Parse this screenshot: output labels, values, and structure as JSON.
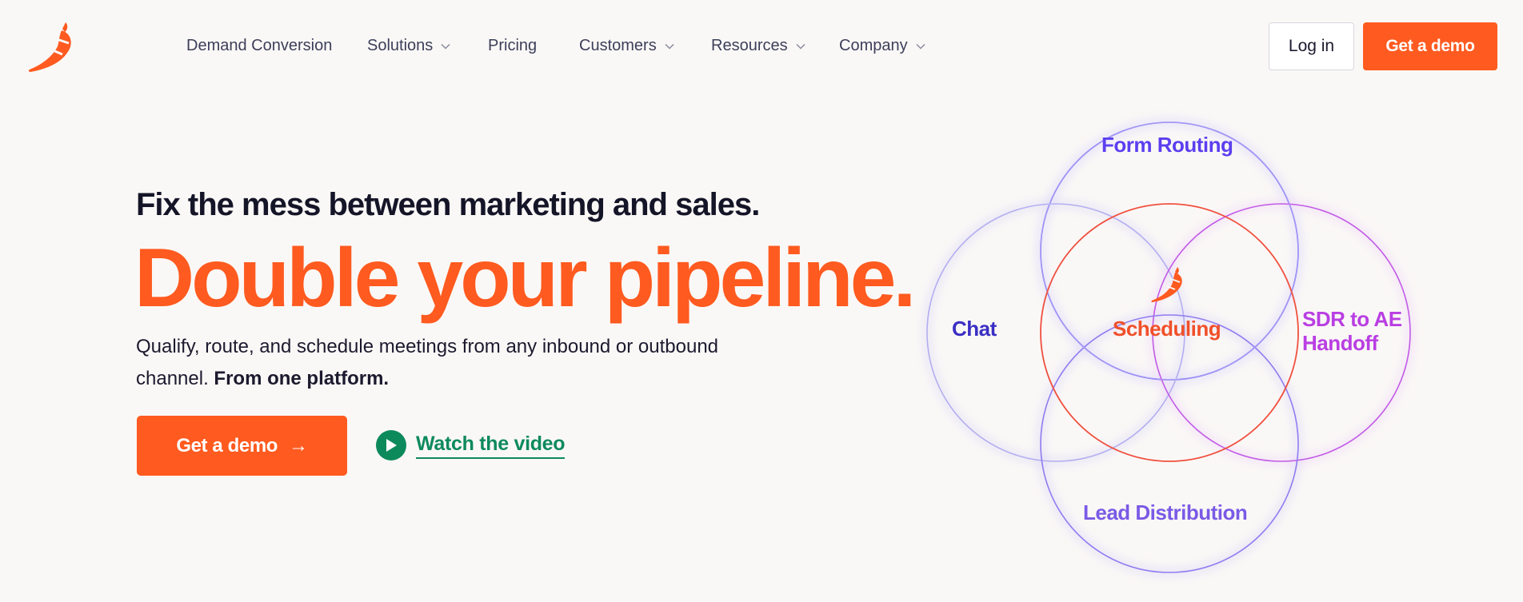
{
  "nav": {
    "items": [
      {
        "label": "Demand Conversion",
        "has_dropdown": false
      },
      {
        "label": "Solutions",
        "has_dropdown": true
      },
      {
        "label": "Pricing",
        "has_dropdown": false
      },
      {
        "label": "Customers",
        "has_dropdown": true
      },
      {
        "label": "Resources",
        "has_dropdown": true
      },
      {
        "label": "Company",
        "has_dropdown": true
      }
    ],
    "login_label": "Log in",
    "demo_label": "Get a demo"
  },
  "hero": {
    "eyebrow": "Fix the mess between marketing and sales.",
    "title": "Double your pipeline.",
    "subtitle_regular": "Qualify, route, and schedule meetings from any inbound or outbound channel. ",
    "subtitle_bold": "From one platform.",
    "cta_label": "Get a demo",
    "cta_arrow": "→",
    "video_label": "Watch the video"
  },
  "diagram": {
    "center": "Scheduling",
    "top": "Form Routing",
    "left": "Chat",
    "right_line1": "SDR to AE",
    "right_line2": "Handoff",
    "bottom": "Lead Distribution"
  },
  "colors": {
    "brand_orange": "#ff5a1f",
    "indigo": "#5b3ff0",
    "navy_indigo": "#3a2fc4",
    "magenta": "#b93ee3",
    "lavender": "#7a5ae6",
    "green": "#0d8a5c"
  },
  "icons": {
    "logo": "chili-pepper-icon",
    "dropdown": "chevron-down-icon",
    "play": "play-icon"
  }
}
